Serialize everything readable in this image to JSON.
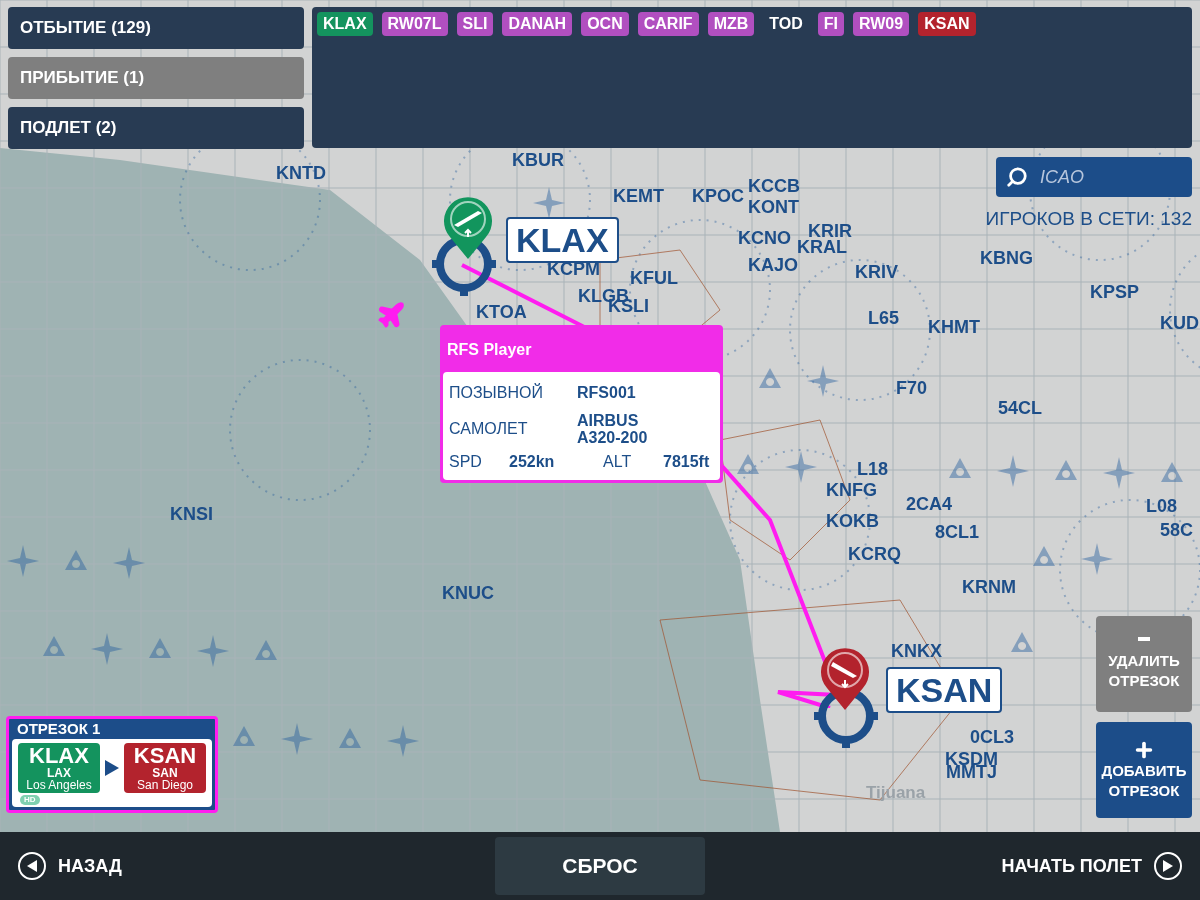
{
  "mode_tabs": [
    {
      "label": "ОТБЫТИЕ (129)",
      "selected": false
    },
    {
      "label": "ПРИБЫТИЕ (1)",
      "selected": true
    },
    {
      "label": "ПОДЛЕТ (2)",
      "selected": false
    }
  ],
  "route_tags": [
    {
      "label": "KLAX",
      "kind": "origin"
    },
    {
      "label": "RW07L",
      "kind": "waypoint"
    },
    {
      "label": "SLI",
      "kind": "waypoint"
    },
    {
      "label": "DANAH",
      "kind": "waypoint"
    },
    {
      "label": "OCN",
      "kind": "waypoint"
    },
    {
      "label": "CARIF",
      "kind": "waypoint"
    },
    {
      "label": "MZB",
      "kind": "waypoint"
    },
    {
      "label": "TOD",
      "kind": "marker"
    },
    {
      "label": "FI",
      "kind": "waypoint"
    },
    {
      "label": "RW09",
      "kind": "waypoint"
    },
    {
      "label": "KSAN",
      "kind": "destination"
    }
  ],
  "search": {
    "placeholder": "ICAO"
  },
  "online_players": "ИГРОКОВ В СЕТИ: 132",
  "map_labels": [
    {
      "text": "KNTD"
    },
    {
      "text": "KBUR"
    },
    {
      "text": "KEMT"
    },
    {
      "text": "KPOC"
    },
    {
      "text": "KCCB"
    },
    {
      "text": "KONT"
    },
    {
      "text": "KCNO"
    },
    {
      "text": "KRIR"
    },
    {
      "text": "KRAL"
    },
    {
      "text": "KAJO"
    },
    {
      "text": "KRIV"
    },
    {
      "text": "KBNG"
    },
    {
      "text": "KPSP"
    },
    {
      "text": "KUD"
    },
    {
      "text": "KCPM"
    },
    {
      "text": "KFUL"
    },
    {
      "text": "KTOA"
    },
    {
      "text": "KLGB"
    },
    {
      "text": "KSLI"
    },
    {
      "text": "L65"
    },
    {
      "text": "KHMT"
    },
    {
      "text": "F70"
    },
    {
      "text": "54CL"
    },
    {
      "text": "L18"
    },
    {
      "text": "KNFG"
    },
    {
      "text": "2CA4"
    },
    {
      "text": "KOKB"
    },
    {
      "text": "8CL1"
    },
    {
      "text": "KCRQ"
    },
    {
      "text": "KRNM"
    },
    {
      "text": "L08"
    },
    {
      "text": "58C"
    },
    {
      "text": "KNKX"
    },
    {
      "text": "0CL3"
    },
    {
      "text": "KSDM"
    },
    {
      "text": "MMTJ"
    },
    {
      "text": "KNSI"
    },
    {
      "text": "KNUC"
    }
  ],
  "city_label": "Tijuana",
  "origin_pin": {
    "code": "KLAX"
  },
  "destination_pin": {
    "code": "KSAN"
  },
  "player_popup": {
    "title": "RFS Player",
    "callsign_label": "ПОЗЫВНОЙ",
    "callsign": "RFS001",
    "aircraft_label": "САМОЛЕТ",
    "aircraft": "AIRBUS A320-200",
    "speed_label": "SPD",
    "speed": "252kn",
    "altitude_label": "ALT",
    "altitude": "7815ft"
  },
  "segment": {
    "title": "ОТРЕЗОК 1",
    "from": {
      "icao": "KLAX",
      "iata": "LAX",
      "city": "Los Angeles"
    },
    "to": {
      "icao": "KSAN",
      "iata": "SAN",
      "city": "San Diego"
    },
    "badge": "HD"
  },
  "segment_buttons": [
    {
      "label": "УДАЛИТЬ ОТРЕЗОК",
      "kind": "remove",
      "disabled": true
    },
    {
      "label": "ДОБАВИТЬ ОТРЕЗОК",
      "kind": "add",
      "disabled": false
    }
  ],
  "bottom_bar": {
    "back": "НАЗАД",
    "reset": "СБРОС",
    "start": "НАЧАТЬ ПОЛЕТ"
  }
}
